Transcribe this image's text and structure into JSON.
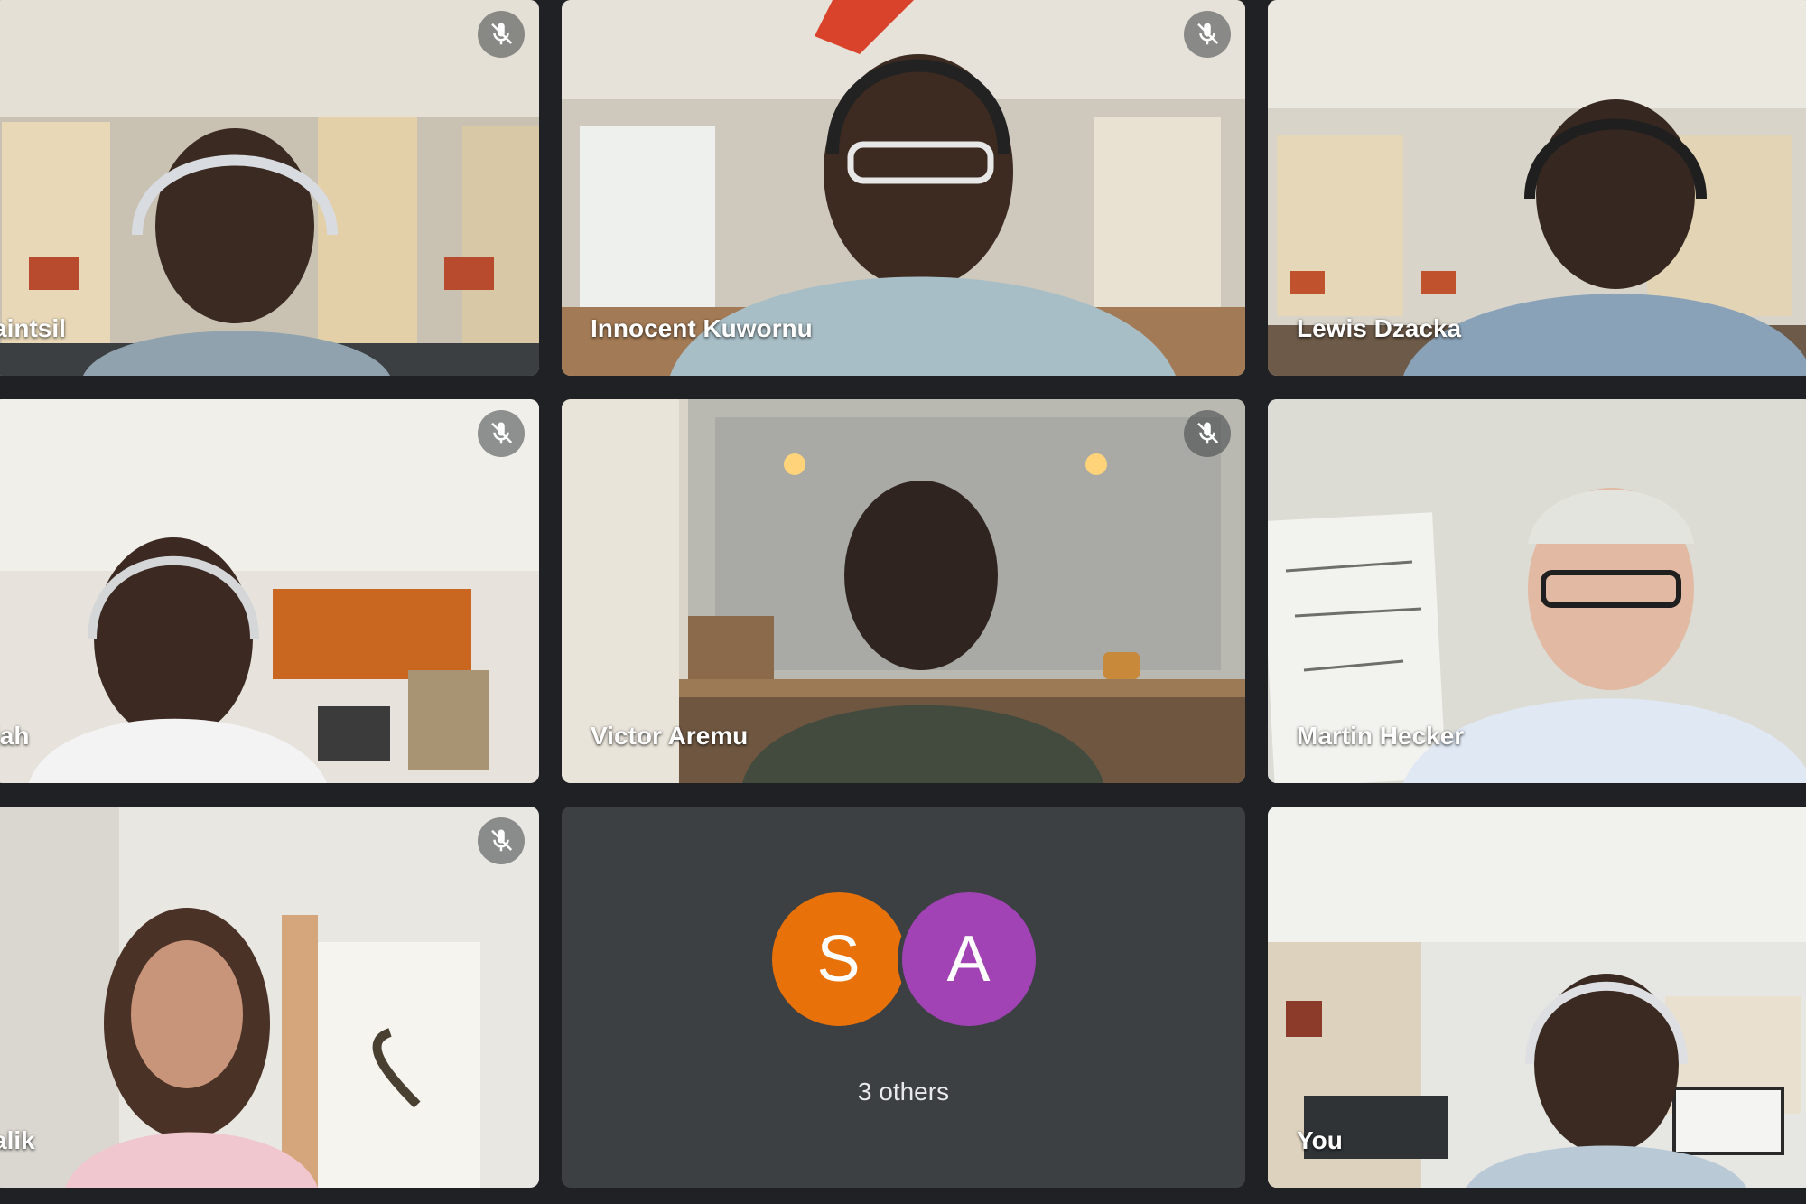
{
  "participants": [
    {
      "name": "aintsil",
      "muted": true
    },
    {
      "name": "Innocent Kuwornu",
      "muted": true
    },
    {
      "name": "Lewis Dzacka",
      "muted": false
    },
    {
      "name": "jah",
      "muted": true
    },
    {
      "name": "Victor Aremu",
      "muted": true
    },
    {
      "name": "Martin Hecker",
      "muted": false,
      "active_speaker": true
    },
    {
      "name": "alik",
      "muted": true
    },
    {
      "name": "You",
      "muted": false
    }
  ],
  "others_tile": {
    "avatars": [
      {
        "initial": "S",
        "color": "#e8710a"
      },
      {
        "initial": "A",
        "color": "#a142b5"
      }
    ],
    "label": "3 others"
  },
  "colors": {
    "background": "#202124",
    "active_speaker_border": "#8ab4f8"
  },
  "icons": {
    "muted": "mic-off-icon"
  }
}
